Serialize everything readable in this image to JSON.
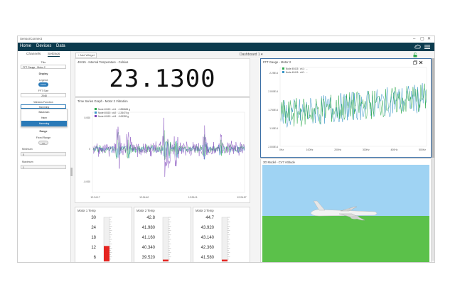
{
  "window": {
    "title": "SensorConnect",
    "controls": [
      "–",
      "▢",
      "✕"
    ]
  },
  "nav": {
    "home": "Home",
    "devices": "Devices",
    "data": "Data"
  },
  "sidebar": {
    "tabs": [
      "Channels",
      "Settings"
    ],
    "title_label": "Title",
    "title_value": "FFT Gauge - Motor 2",
    "display_heading": "Display",
    "legend_label": "Legend",
    "legend_toggle": "Active",
    "fft_size_label": "FFT Size",
    "fft_size_value": "2048",
    "window_function_label": "Window Function",
    "window_function_value": "Hamming",
    "window_options": [
      "Blackman",
      "Hann",
      "Hamming"
    ],
    "range_heading": "Range",
    "fixed_range_label": "Fixed Range",
    "fixed_range_toggle": "Off",
    "minimum_label": "Minimum",
    "minimum_value": "0",
    "maximum_label": "Maximum",
    "maximum_value": "1"
  },
  "toolbar": {
    "add_widget": "+ Add Widget",
    "dashboard": "Dashboard 1",
    "dashboard_caret": "▾"
  },
  "temp_widget": {
    "title": "40415 - Internal Temperature - Celsius",
    "value": "23.1300"
  },
  "timeseries": {
    "title": "Time Series Graph - Motor 2 Vibration",
    "legend": [
      "Node 40415 : ch1 : -1.856684 g",
      "Node 40415 : ch2 : -1.26474 g",
      "Node 40415 : ch3 : -0.69289 g"
    ],
    "y_ticks": [
      "0.000",
      "0",
      "-0.000"
    ],
    "x_ticks": [
      "12:24:17",
      "12:24:40",
      "12:26:11",
      "12:26:57"
    ]
  },
  "fft": {
    "title": "FFT Gauge - Motor 2",
    "legend": [
      "Node 40415 : ch1 : ...",
      "Node 40415 : ch2 : ..."
    ],
    "y_ticks": [
      "2.25E-6",
      "2.000E-6",
      "1.750E-6",
      "1.50E-6",
      "2.000E-6"
    ],
    "x_ticks": [
      "0Hz",
      "100Hz",
      "200Hz",
      "300Hz",
      "400Hz",
      "500Hz"
    ]
  },
  "model3d": {
    "title": "3D Model - CV7 Attitude"
  },
  "gauges": [
    {
      "title": "Motor 1 Temp",
      "ticks": [
        "30",
        "24",
        "18",
        "12",
        "6"
      ],
      "fill": 0.35
    },
    {
      "title": "Motor 2 Temp",
      "ticks": [
        "42.8",
        "41.980",
        "41.160",
        "40.340",
        "39.520"
      ],
      "fill": 0.04
    },
    {
      "title": "Motor 3 Temp",
      "ticks": [
        "44.7",
        "43.920",
        "43.140",
        "42.360",
        "41.580"
      ],
      "fill": 0.04
    }
  ],
  "colors": {
    "nav": "#0c3b4e",
    "ch1": "#2eaa4e",
    "ch2": "#3a96c8",
    "ch3": "#7a40b8",
    "gauge_fill": "#e52420",
    "ground": "#5bc14a",
    "sky": "#9fd3f3"
  }
}
